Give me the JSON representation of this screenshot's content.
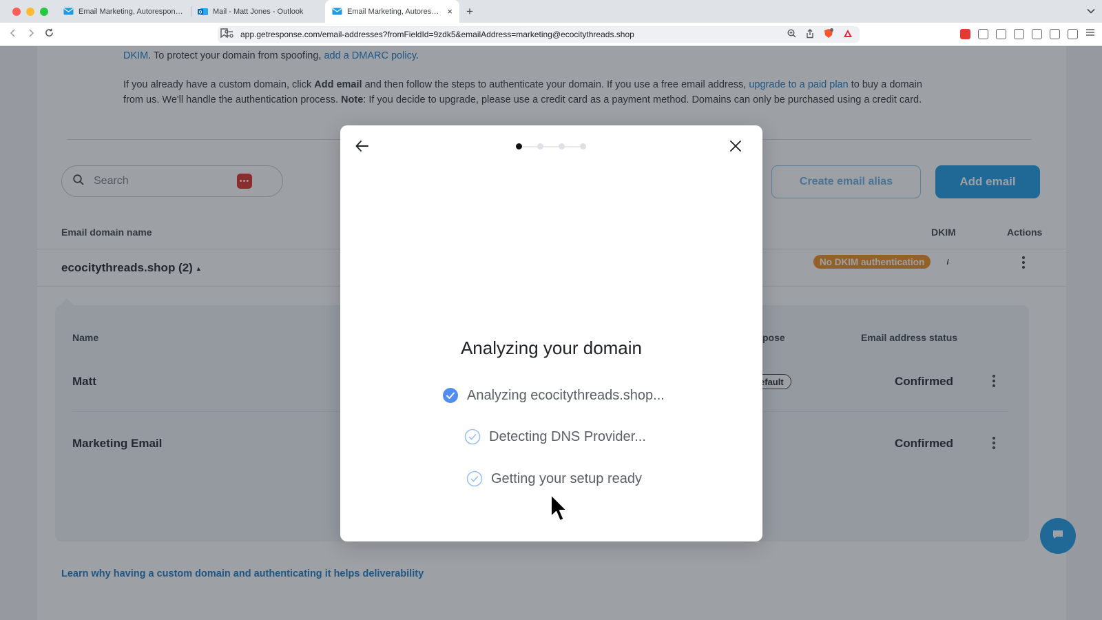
{
  "browser": {
    "tabs": [
      {
        "title": "Email Marketing, Autoresponder,",
        "active": false
      },
      {
        "title": "Mail - Matt Jones - Outlook",
        "active": false
      },
      {
        "title": "Email Marketing, Autorespon",
        "active": true
      }
    ],
    "new_tab_label": "+",
    "close_label": "×",
    "url": "app.getresponse.com/email-addresses?fromFieldId=9zdk5&emailAddress=marketing@ecocitythreads.shop"
  },
  "page": {
    "intro_line1_link_dkim": "DKIM",
    "intro_line1_text": ". To protect your domain from spoofing, ",
    "intro_line1_link_dmarc": "add a DMARC policy",
    "intro_line1_end": ".",
    "intro_p2_part1": "If you already have a custom domain, click ",
    "intro_p2_bold1": "Add email",
    "intro_p2_part2": " and then follow the steps to authenticate your domain. If you use a free email address, ",
    "intro_p2_link": "upgrade to a paid plan",
    "intro_p2_part3": " to buy a domain",
    "intro_p2_line2_part1": "from us. We'll handle the authentication process. ",
    "intro_p2_bold2": "Note",
    "intro_p2_line2_part2": ": If you decide to upgrade, please use a credit card as a payment method. Domains can only be purchased using a credit card.",
    "search_placeholder": "Search",
    "search_badge": "•••",
    "create_alias_label": "Create email alias",
    "add_email_label": "Add email",
    "table": {
      "col_domain": "Email domain name",
      "col_dkim": "DKIM",
      "col_actions": "Actions",
      "domain_name": "ecocitythreads.shop (2)",
      "dkim_badge": "No DKIM authentication",
      "info_label": "i"
    },
    "subtable": {
      "col_name": "Name",
      "col_purpose_fragment": "pose",
      "col_status": "Email address status",
      "rows": [
        {
          "name": "Matt",
          "purpose_fragment": "efault",
          "status": "Confirmed"
        },
        {
          "name": "Marketing Email",
          "status": "Confirmed"
        }
      ]
    },
    "footer_link": "Learn why having a custom domain and authenticating it helps deliverability"
  },
  "modal": {
    "title": "Analyzing your domain",
    "step_count": 4,
    "active_step": 1,
    "checks": [
      {
        "label": "Analyzing ecocitythreads.shop...",
        "done": true
      },
      {
        "label": "Detecting DNS Provider...",
        "done": false
      },
      {
        "label": "Getting your setup ready",
        "done": false
      }
    ]
  },
  "colors": {
    "primary": "#1d9be5",
    "link": "#1a78c2",
    "warning": "#f18a1c",
    "check_done": "#4f8df0",
    "check_pending": "#9cc0f2"
  }
}
